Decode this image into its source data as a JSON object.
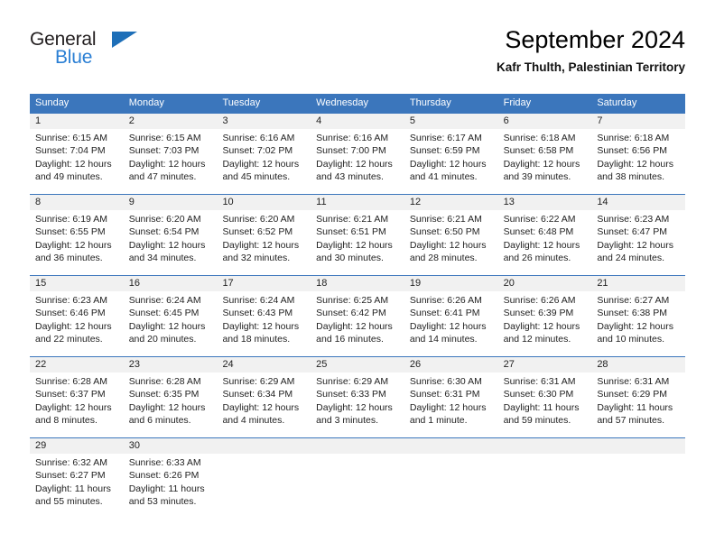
{
  "brand": {
    "name_part1": "General",
    "name_part2": "Blue",
    "triangle_color": "#1e6fb8",
    "blue_color": "#2a7fd4"
  },
  "header": {
    "title": "September 2024",
    "subtitle": "Kafr Thulth, Palestinian Territory"
  },
  "theme": {
    "header_blue": "#3b76bc",
    "daynum_band": "#f1f1f1",
    "text": "#222222"
  },
  "weekdays": [
    "Sunday",
    "Monday",
    "Tuesday",
    "Wednesday",
    "Thursday",
    "Friday",
    "Saturday"
  ],
  "weeks": [
    {
      "daynums": [
        "1",
        "2",
        "3",
        "4",
        "5",
        "6",
        "7"
      ],
      "cells": [
        {
          "sunrise": "Sunrise: 6:15 AM",
          "sunset": "Sunset: 7:04 PM",
          "daylight1": "Daylight: 12 hours",
          "daylight2": "and 49 minutes."
        },
        {
          "sunrise": "Sunrise: 6:15 AM",
          "sunset": "Sunset: 7:03 PM",
          "daylight1": "Daylight: 12 hours",
          "daylight2": "and 47 minutes."
        },
        {
          "sunrise": "Sunrise: 6:16 AM",
          "sunset": "Sunset: 7:02 PM",
          "daylight1": "Daylight: 12 hours",
          "daylight2": "and 45 minutes."
        },
        {
          "sunrise": "Sunrise: 6:16 AM",
          "sunset": "Sunset: 7:00 PM",
          "daylight1": "Daylight: 12 hours",
          "daylight2": "and 43 minutes."
        },
        {
          "sunrise": "Sunrise: 6:17 AM",
          "sunset": "Sunset: 6:59 PM",
          "daylight1": "Daylight: 12 hours",
          "daylight2": "and 41 minutes."
        },
        {
          "sunrise": "Sunrise: 6:18 AM",
          "sunset": "Sunset: 6:58 PM",
          "daylight1": "Daylight: 12 hours",
          "daylight2": "and 39 minutes."
        },
        {
          "sunrise": "Sunrise: 6:18 AM",
          "sunset": "Sunset: 6:56 PM",
          "daylight1": "Daylight: 12 hours",
          "daylight2": "and 38 minutes."
        }
      ]
    },
    {
      "daynums": [
        "8",
        "9",
        "10",
        "11",
        "12",
        "13",
        "14"
      ],
      "cells": [
        {
          "sunrise": "Sunrise: 6:19 AM",
          "sunset": "Sunset: 6:55 PM",
          "daylight1": "Daylight: 12 hours",
          "daylight2": "and 36 minutes."
        },
        {
          "sunrise": "Sunrise: 6:20 AM",
          "sunset": "Sunset: 6:54 PM",
          "daylight1": "Daylight: 12 hours",
          "daylight2": "and 34 minutes."
        },
        {
          "sunrise": "Sunrise: 6:20 AM",
          "sunset": "Sunset: 6:52 PM",
          "daylight1": "Daylight: 12 hours",
          "daylight2": "and 32 minutes."
        },
        {
          "sunrise": "Sunrise: 6:21 AM",
          "sunset": "Sunset: 6:51 PM",
          "daylight1": "Daylight: 12 hours",
          "daylight2": "and 30 minutes."
        },
        {
          "sunrise": "Sunrise: 6:21 AM",
          "sunset": "Sunset: 6:50 PM",
          "daylight1": "Daylight: 12 hours",
          "daylight2": "and 28 minutes."
        },
        {
          "sunrise": "Sunrise: 6:22 AM",
          "sunset": "Sunset: 6:48 PM",
          "daylight1": "Daylight: 12 hours",
          "daylight2": "and 26 minutes."
        },
        {
          "sunrise": "Sunrise: 6:23 AM",
          "sunset": "Sunset: 6:47 PM",
          "daylight1": "Daylight: 12 hours",
          "daylight2": "and 24 minutes."
        }
      ]
    },
    {
      "daynums": [
        "15",
        "16",
        "17",
        "18",
        "19",
        "20",
        "21"
      ],
      "cells": [
        {
          "sunrise": "Sunrise: 6:23 AM",
          "sunset": "Sunset: 6:46 PM",
          "daylight1": "Daylight: 12 hours",
          "daylight2": "and 22 minutes."
        },
        {
          "sunrise": "Sunrise: 6:24 AM",
          "sunset": "Sunset: 6:45 PM",
          "daylight1": "Daylight: 12 hours",
          "daylight2": "and 20 minutes."
        },
        {
          "sunrise": "Sunrise: 6:24 AM",
          "sunset": "Sunset: 6:43 PM",
          "daylight1": "Daylight: 12 hours",
          "daylight2": "and 18 minutes."
        },
        {
          "sunrise": "Sunrise: 6:25 AM",
          "sunset": "Sunset: 6:42 PM",
          "daylight1": "Daylight: 12 hours",
          "daylight2": "and 16 minutes."
        },
        {
          "sunrise": "Sunrise: 6:26 AM",
          "sunset": "Sunset: 6:41 PM",
          "daylight1": "Daylight: 12 hours",
          "daylight2": "and 14 minutes."
        },
        {
          "sunrise": "Sunrise: 6:26 AM",
          "sunset": "Sunset: 6:39 PM",
          "daylight1": "Daylight: 12 hours",
          "daylight2": "and 12 minutes."
        },
        {
          "sunrise": "Sunrise: 6:27 AM",
          "sunset": "Sunset: 6:38 PM",
          "daylight1": "Daylight: 12 hours",
          "daylight2": "and 10 minutes."
        }
      ]
    },
    {
      "daynums": [
        "22",
        "23",
        "24",
        "25",
        "26",
        "27",
        "28"
      ],
      "cells": [
        {
          "sunrise": "Sunrise: 6:28 AM",
          "sunset": "Sunset: 6:37 PM",
          "daylight1": "Daylight: 12 hours",
          "daylight2": "and 8 minutes."
        },
        {
          "sunrise": "Sunrise: 6:28 AM",
          "sunset": "Sunset: 6:35 PM",
          "daylight1": "Daylight: 12 hours",
          "daylight2": "and 6 minutes."
        },
        {
          "sunrise": "Sunrise: 6:29 AM",
          "sunset": "Sunset: 6:34 PM",
          "daylight1": "Daylight: 12 hours",
          "daylight2": "and 4 minutes."
        },
        {
          "sunrise": "Sunrise: 6:29 AM",
          "sunset": "Sunset: 6:33 PM",
          "daylight1": "Daylight: 12 hours",
          "daylight2": "and 3 minutes."
        },
        {
          "sunrise": "Sunrise: 6:30 AM",
          "sunset": "Sunset: 6:31 PM",
          "daylight1": "Daylight: 12 hours",
          "daylight2": "and 1 minute."
        },
        {
          "sunrise": "Sunrise: 6:31 AM",
          "sunset": "Sunset: 6:30 PM",
          "daylight1": "Daylight: 11 hours",
          "daylight2": "and 59 minutes."
        },
        {
          "sunrise": "Sunrise: 6:31 AM",
          "sunset": "Sunset: 6:29 PM",
          "daylight1": "Daylight: 11 hours",
          "daylight2": "and 57 minutes."
        }
      ]
    },
    {
      "daynums": [
        "29",
        "30",
        "",
        "",
        "",
        "",
        ""
      ],
      "cells": [
        {
          "sunrise": "Sunrise: 6:32 AM",
          "sunset": "Sunset: 6:27 PM",
          "daylight1": "Daylight: 11 hours",
          "daylight2": "and 55 minutes."
        },
        {
          "sunrise": "Sunrise: 6:33 AM",
          "sunset": "Sunset: 6:26 PM",
          "daylight1": "Daylight: 11 hours",
          "daylight2": "and 53 minutes."
        },
        {
          "sunrise": "",
          "sunset": "",
          "daylight1": "",
          "daylight2": ""
        },
        {
          "sunrise": "",
          "sunset": "",
          "daylight1": "",
          "daylight2": ""
        },
        {
          "sunrise": "",
          "sunset": "",
          "daylight1": "",
          "daylight2": ""
        },
        {
          "sunrise": "",
          "sunset": "",
          "daylight1": "",
          "daylight2": ""
        },
        {
          "sunrise": "",
          "sunset": "",
          "daylight1": "",
          "daylight2": ""
        }
      ]
    }
  ]
}
